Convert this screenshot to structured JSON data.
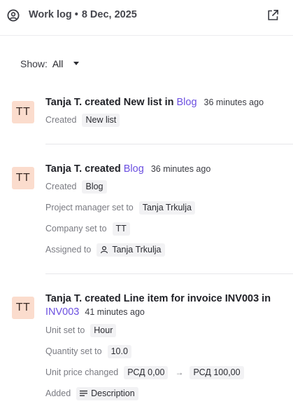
{
  "header": {
    "title": "Work log",
    "separator": "•",
    "date": "8 Dec, 2025"
  },
  "filter": {
    "label": "Show:",
    "value": "All"
  },
  "entries": [
    {
      "avatar": "TT",
      "title": "Tanja T. created New list in",
      "link": "Blog",
      "time": "36 minutes ago",
      "details": [
        {
          "label": "Created",
          "value": "New list"
        }
      ]
    },
    {
      "avatar": "TT",
      "title": "Tanja T. created",
      "link": "Blog",
      "time": "36 minutes ago",
      "details": [
        {
          "label": "Created",
          "value": "Blog"
        },
        {
          "label": "Project manager set to",
          "value": "Tanja Trkulja"
        },
        {
          "label": "Company set to",
          "value": "TT"
        },
        {
          "label": "Assigned to",
          "value": "Tanja Trkulja",
          "icon": "user-icon"
        }
      ]
    },
    {
      "avatar": "TT",
      "title": "Tanja T. created Line item for invoice INV003 in",
      "link": "INV003",
      "time": "41 minutes ago",
      "details": [
        {
          "label": "Unit set to",
          "value": "Hour"
        },
        {
          "label": "Quantity set to",
          "value": "10.0"
        },
        {
          "label": "Unit price changed",
          "old_value": "РСД 0,00",
          "arrow": "→",
          "new_value": "РСД 100,00"
        },
        {
          "label": "Added",
          "value": "Description",
          "icon": "text-lines-icon"
        }
      ]
    }
  ]
}
